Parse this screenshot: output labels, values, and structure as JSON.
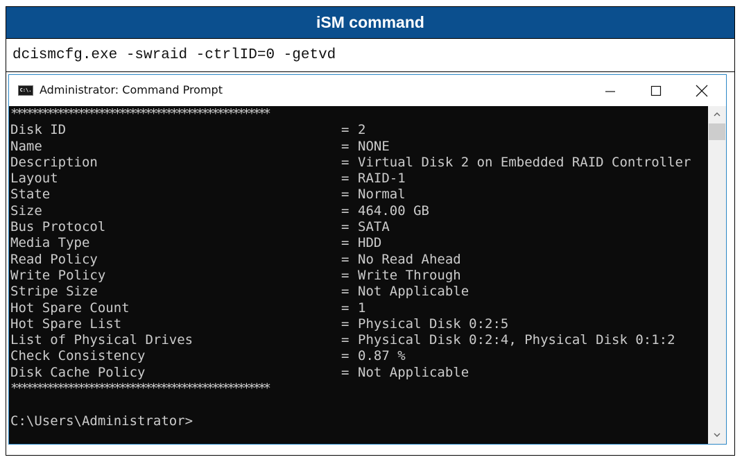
{
  "header": {
    "title": "iSM command"
  },
  "command": {
    "text": "dcismcfg.exe -swraid -ctrlID=0 -getvd"
  },
  "window": {
    "title": "Administrator: Command Prompt",
    "icon_label": "C:\\.",
    "icons": [
      "minimize-icon",
      "maximize-icon",
      "close-icon",
      "scroll-up-icon",
      "scroll-down-icon"
    ]
  },
  "console": {
    "separator": "**************************************************",
    "rows": [
      {
        "key": "Disk ID",
        "sep": "=",
        "value": "2"
      },
      {
        "key": "Name",
        "sep": "=",
        "value": "NONE"
      },
      {
        "key": "Description",
        "sep": "=",
        "value": "Virtual Disk 2 on Embedded RAID Controller"
      },
      {
        "key": "Layout",
        "sep": "=",
        "value": "RAID-1"
      },
      {
        "key": "State",
        "sep": "=",
        "value": "Normal"
      },
      {
        "key": "Size",
        "sep": "=",
        "value": "464.00 GB"
      },
      {
        "key": "Bus Protocol",
        "sep": "=",
        "value": "SATA"
      },
      {
        "key": "Media Type",
        "sep": "=",
        "value": "HDD"
      },
      {
        "key": "Read Policy",
        "sep": "=",
        "value": "No Read Ahead"
      },
      {
        "key": "Write Policy",
        "sep": "=",
        "value": "Write Through"
      },
      {
        "key": "Stripe Size",
        "sep": "=",
        "value": "Not Applicable"
      },
      {
        "key": "Hot Spare Count",
        "sep": "=",
        "value": "1"
      },
      {
        "key": "Hot Spare List",
        "sep": "=",
        "value": "Physical Disk 0:2:5"
      },
      {
        "key": "List of Physical Drives",
        "sep": "=",
        "value": "Physical Disk 0:2:4, Physical Disk 0:1:2"
      },
      {
        "key": "Check Consistency",
        "sep": "=",
        "value": "0.87 %"
      },
      {
        "key": "Disk Cache Policy",
        "sep": "=",
        "value": "Not Applicable"
      }
    ],
    "prompt": "C:\\Users\\Administrator>"
  },
  "colors": {
    "header_bg": "#0b4f8e",
    "console_bg": "#0c0c0c",
    "console_text": "#cccccc",
    "window_border": "#2b87c6"
  }
}
